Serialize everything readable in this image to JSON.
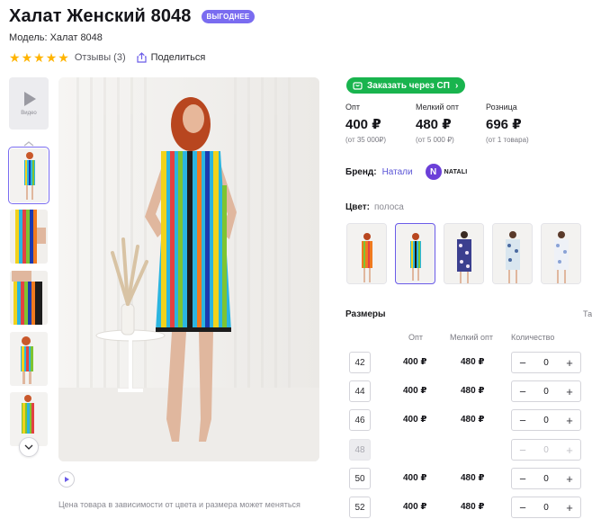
{
  "product": {
    "title": "Халат Женский 8048",
    "badge": "ВЫГОДНЕЕ",
    "model_label": "Модель: Халат 8048",
    "rating": 5,
    "reviews_label": "Отзывы (3)",
    "share_label": "Поделиться"
  },
  "gallery": {
    "video_label": "Видео",
    "price_note": "Цена товара в зависимости от цвета и размера может меняться"
  },
  "order_button": {
    "label": "Заказать через СП"
  },
  "prices": [
    {
      "header": "Опт",
      "value": "400 ₽",
      "note": "(от 35 000₽)"
    },
    {
      "header": "Мелкий опт",
      "value": "480 ₽",
      "note": "(от 5 000 ₽)"
    },
    {
      "header": "Розница",
      "value": "696 ₽",
      "note": "(от 1 товара)"
    }
  ],
  "brand": {
    "label": "Бренд:",
    "value": "Натали",
    "logo_letter": "N",
    "logo_text": "NATALI"
  },
  "color": {
    "label": "Цвет:",
    "value": "полоса"
  },
  "sizes": {
    "title": "Размеры",
    "table_link": "Та",
    "columns": {
      "opt": "Опт",
      "small_opt": "Мелкий опт",
      "qty": "Количество"
    },
    "rows": [
      {
        "size": "42",
        "opt": "400 ₽",
        "small_opt": "480 ₽",
        "qty": "0",
        "available": true
      },
      {
        "size": "44",
        "opt": "400 ₽",
        "small_opt": "480 ₽",
        "qty": "0",
        "available": true
      },
      {
        "size": "46",
        "opt": "400 ₽",
        "small_opt": "480 ₽",
        "qty": "0",
        "available": true
      },
      {
        "size": "48",
        "opt": "",
        "small_opt": "",
        "qty": "0",
        "available": false
      },
      {
        "size": "50",
        "opt": "400 ₽",
        "small_opt": "480 ₽",
        "qty": "0",
        "available": true
      },
      {
        "size": "52",
        "opt": "400 ₽",
        "small_opt": "480 ₽",
        "qty": "0",
        "available": true
      }
    ],
    "minus": "−",
    "plus": "+"
  },
  "colors": {
    "accent": "#7a6cf0",
    "green": "#19b44e",
    "star": "#ffb400",
    "link": "#5a54d6"
  }
}
